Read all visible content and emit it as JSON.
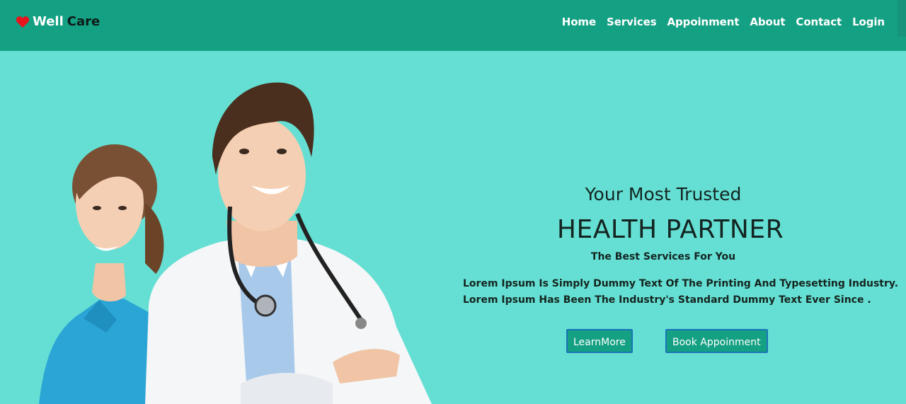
{
  "brand": {
    "word1": "Well",
    "word2": "Care"
  },
  "nav": [
    {
      "label": "Home"
    },
    {
      "label": "Services"
    },
    {
      "label": "Appoinment"
    },
    {
      "label": "About"
    },
    {
      "label": "Contact"
    },
    {
      "label": "Login"
    }
  ],
  "hero": {
    "line1": "Your Most Trusted",
    "line2": "HEALTH PARTNER",
    "line3": "The Best Services For You",
    "para1": "Lorem Ipsum Is Simply Dummy Text Of The Printing And Typesetting Industry.",
    "para2": "Lorem Ipsum Has Been The Industry's Standard Dummy Text Ever Since .",
    "btn_learn": "LearnMore",
    "btn_book": "Book Appoinment"
  },
  "colors": {
    "navbar": "#14a083",
    "background": "#65dfd3",
    "heart": "#e8141c",
    "button": "#14a083"
  },
  "icons": {
    "logo": "heart-icon"
  }
}
